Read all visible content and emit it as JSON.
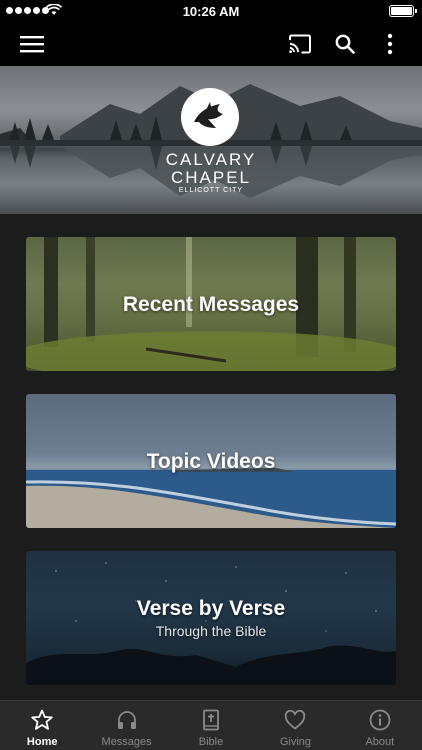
{
  "status_bar": {
    "time": "10:26 AM",
    "battery_level": 1.0
  },
  "toolbar": {
    "menu_icon": "hamburger-menu-icon",
    "cast_icon": "cast-icon",
    "search_icon": "search-icon",
    "more_icon": "vertical-ellipsis-icon"
  },
  "header": {
    "brand_line1": "CALVARY",
    "brand_line2": "CHAPEL",
    "brand_line3": "ELLICOTT CITY"
  },
  "cards": [
    {
      "title": "Recent Messages",
      "subtitle": ""
    },
    {
      "title": "Topic Videos",
      "subtitle": ""
    },
    {
      "title": "Verse by Verse",
      "subtitle": "Through the Bible"
    }
  ],
  "tabs": [
    {
      "label": "Home",
      "icon": "star-icon",
      "active": true
    },
    {
      "label": "Messages",
      "icon": "headphones-icon",
      "active": false
    },
    {
      "label": "Bible",
      "icon": "bible-icon",
      "active": false
    },
    {
      "label": "Giving",
      "icon": "heart-icon",
      "active": false
    },
    {
      "label": "About",
      "icon": "info-icon",
      "active": false
    }
  ],
  "colors": {
    "bar_bg": "#000000",
    "content_bg": "#1c1c1c",
    "tabbar_bg": "#2a2a2a",
    "tab_inactive": "#8a8a8a",
    "tab_active": "#ffffff"
  }
}
